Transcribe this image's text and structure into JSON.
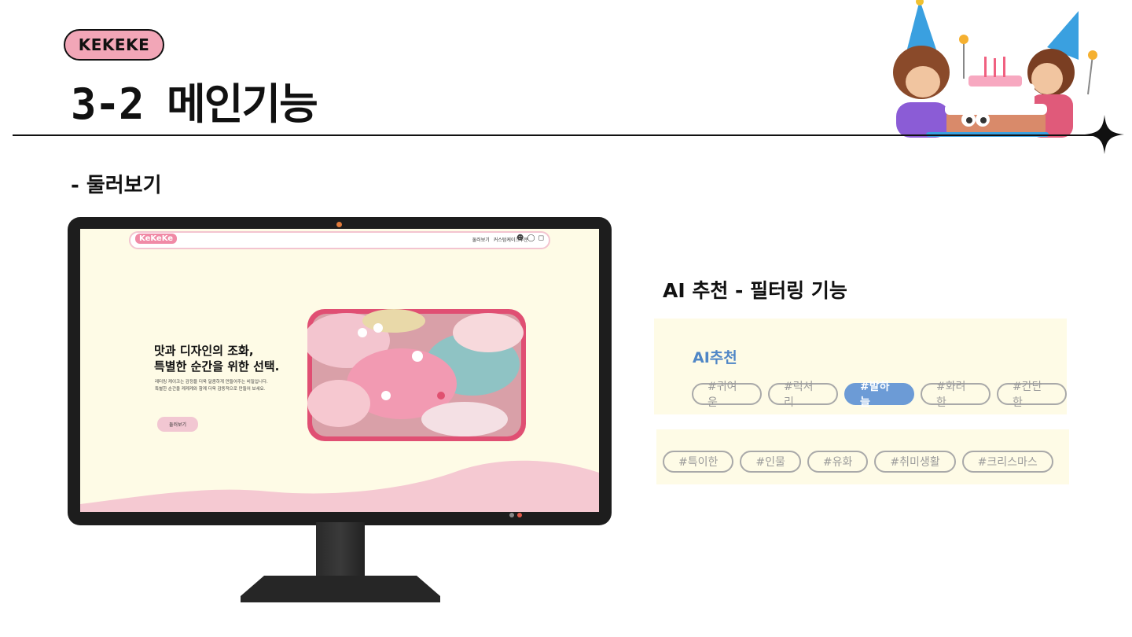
{
  "header": {
    "badge": "KEKEKE",
    "title": "3-2 메인기능"
  },
  "section": {
    "label": "- 둘러보기"
  },
  "site": {
    "logo": "KeKeKe",
    "nav_links": [
      "둘러보기",
      "커스텀케이크주문"
    ],
    "hero_title_line1": "맛과 디자인의 조화,",
    "hero_title_line2": "특별한 순간을 위한 선택.",
    "hero_desc_line1": "레터링 케이크는 감정을 더욱 달콤하게 만들어주는 비밀입니다.",
    "hero_desc_line2": "특별한 순간을 케케케와 함께 더욱 감동적으로 만들어 보세요.",
    "hero_button": "둘러보기"
  },
  "ai_feature": {
    "title": "AI 추천 - 필터링 기능",
    "panel_label": "AI추천",
    "tags_row1": [
      "#귀여운",
      "#럭셔리",
      "#발하늘",
      "#화려한",
      "#간단한"
    ],
    "active_tag": "#발하늘",
    "tags_row2": [
      "#특이한",
      "#인물",
      "#유화",
      "#취미생활",
      "#크리스마스"
    ]
  },
  "colors": {
    "badge_pink": "#f2a6b7",
    "screen_bg": "#fefbe6",
    "hero_frame": "#e04f73",
    "active_tag": "#6c9bd6",
    "accent_blue_text": "#4f86c6"
  }
}
